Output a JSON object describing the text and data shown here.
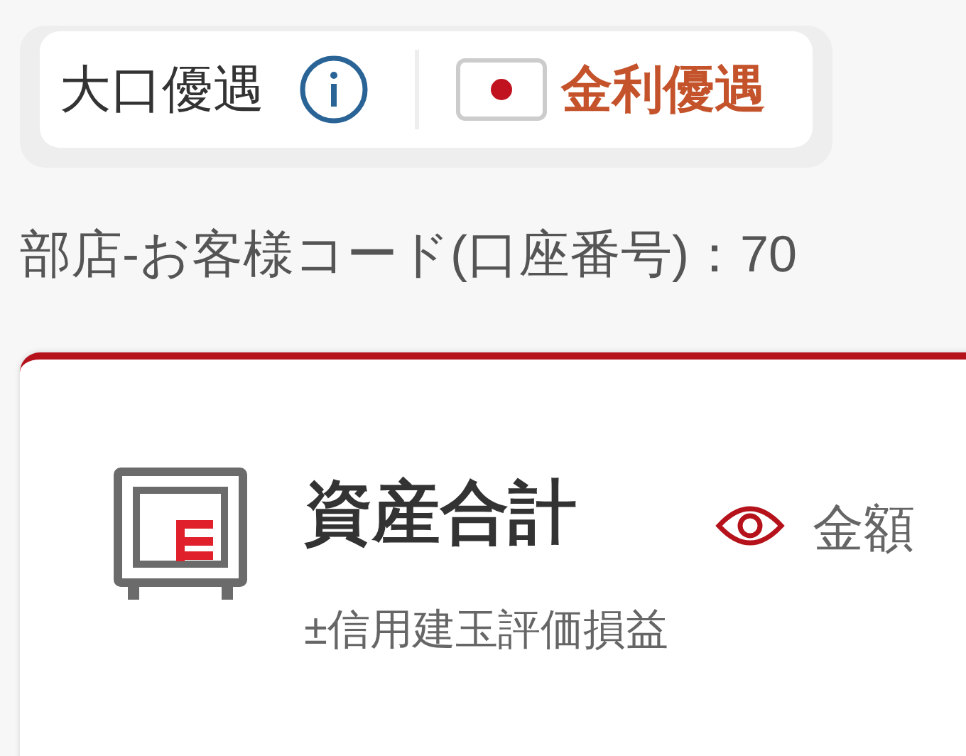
{
  "badges": {
    "large_account": "大口優遇",
    "rate": "金利優遇"
  },
  "account_label": "部店-お客様コード(口座番号)：70",
  "asset_card": {
    "title": "資産合計",
    "toggle_label": "金額",
    "subtitle": "±信用建玉評価損益"
  }
}
